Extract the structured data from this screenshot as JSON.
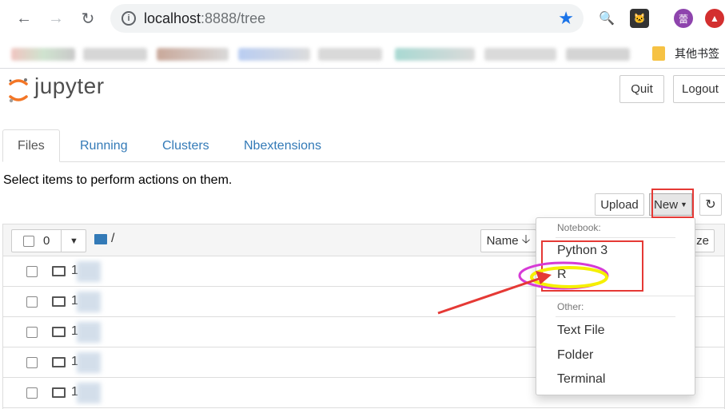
{
  "browser": {
    "url_host": "localhost",
    "url_rest": ":8888/tree",
    "bookmark_folder_label": "其他书签",
    "profile_initial": "蕾"
  },
  "app": {
    "name": "jupyter"
  },
  "header": {
    "quit_label": "Quit",
    "logout_label": "Logout"
  },
  "tabs": [
    {
      "label": "Files",
      "active": true
    },
    {
      "label": "Running",
      "active": false
    },
    {
      "label": "Clusters",
      "active": false
    },
    {
      "label": "Nbextensions",
      "active": false
    }
  ],
  "toolbar": {
    "instruction": "Select items to perform actions on them.",
    "upload_label": "Upload",
    "new_label": "New"
  },
  "list": {
    "selected_count": "0",
    "breadcrumb": "/",
    "sort_label": "Name",
    "sort_label_partial": "ze",
    "rows": [
      {
        "name": "1"
      },
      {
        "name": "1"
      },
      {
        "name": "1"
      },
      {
        "name": "1"
      },
      {
        "name": "1"
      }
    ]
  },
  "new_menu": {
    "notebook_header": "Notebook:",
    "kernels": [
      "Python 3",
      "R"
    ],
    "other_header": "Other:",
    "other_items": [
      "Text File",
      "Folder",
      "Terminal"
    ]
  },
  "colors": {
    "link": "#337ab7",
    "annotation_red": "#e53935",
    "highlight_yellow": "#f5f000",
    "highlight_magenta": "#d63bd6"
  }
}
